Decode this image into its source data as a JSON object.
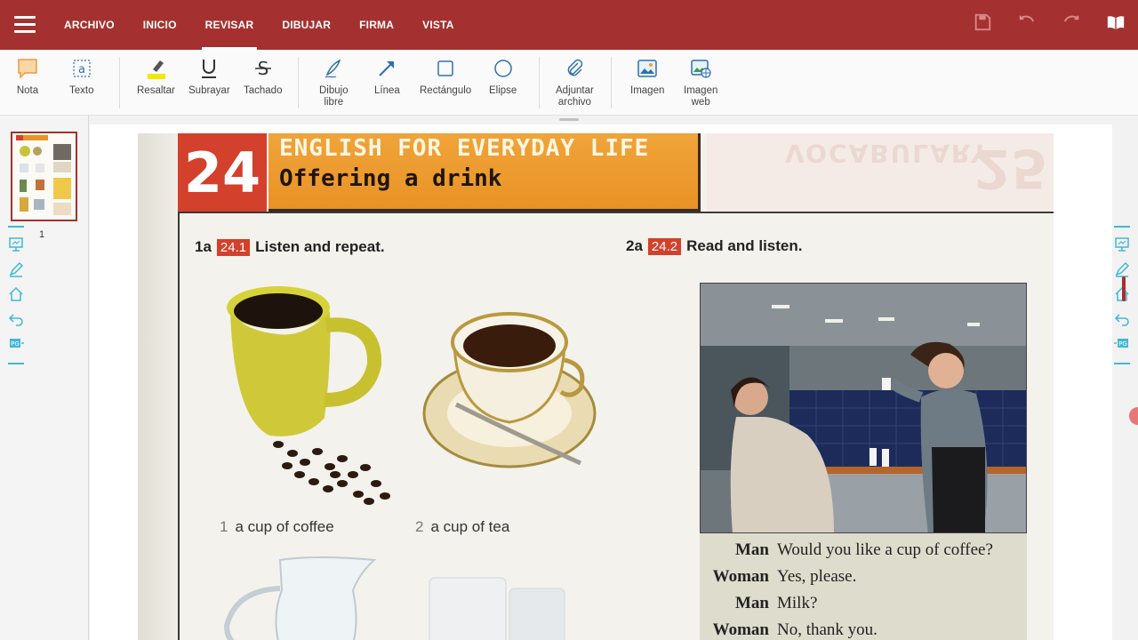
{
  "menu": {
    "tabs": [
      {
        "label": "ARCHIVO"
      },
      {
        "label": "INICIO"
      },
      {
        "label": "REVISAR"
      },
      {
        "label": "DIBUJAR"
      },
      {
        "label": "FIRMA"
      },
      {
        "label": "VISTA"
      }
    ],
    "active_tab": "REVISAR"
  },
  "tools": [
    {
      "label": "Nota",
      "icon": "note-icon"
    },
    {
      "label": "Texto",
      "icon": "text-box-icon"
    },
    {
      "label": "Resaltar",
      "icon": "highlighter-icon"
    },
    {
      "label": "Subrayar",
      "icon": "underline-icon"
    },
    {
      "label": "Tachado",
      "icon": "strikethrough-icon"
    },
    {
      "label": "Dibujo\nlibre",
      "icon": "freehand-pen-icon"
    },
    {
      "label": "Línea",
      "icon": "line-arrow-icon"
    },
    {
      "label": "Rectángulo",
      "icon": "rectangle-icon"
    },
    {
      "label": "Elipse",
      "icon": "ellipse-icon"
    },
    {
      "label": "Adjuntar\narchivo",
      "icon": "paperclip-icon"
    },
    {
      "label": "Imagen",
      "icon": "image-icon"
    },
    {
      "label": "Imagen\nweb",
      "icon": "web-image-icon"
    }
  ],
  "colors": {
    "brand": "#a4312f",
    "accent": "#3fb9d3",
    "highlight": "#f5e600"
  },
  "thumbnails": [
    {
      "page": "1"
    }
  ],
  "page": {
    "unit_number": "24",
    "title": "ENGLISH FOR EVERYDAY LIFE",
    "subtitle": "Offering a drink",
    "ghost_number": "25",
    "ghost_title": "VOCABULARY",
    "section1": {
      "num": "1a",
      "badge": "24.1",
      "text": "Listen and repeat."
    },
    "section2": {
      "num": "2a",
      "badge": "24.2",
      "text": "Read and listen."
    },
    "captions": [
      {
        "num": "1",
        "text": "a cup of coffee"
      },
      {
        "num": "2",
        "text": "a cup of tea"
      }
    ],
    "dialogue": [
      {
        "speaker": "Man",
        "line": "Would you like a cup of coffee?"
      },
      {
        "speaker": "Woman",
        "line": "Yes, please."
      },
      {
        "speaker": "Man",
        "line": "Milk?"
      },
      {
        "speaker": "Woman",
        "line": "No, thank you."
      }
    ]
  }
}
